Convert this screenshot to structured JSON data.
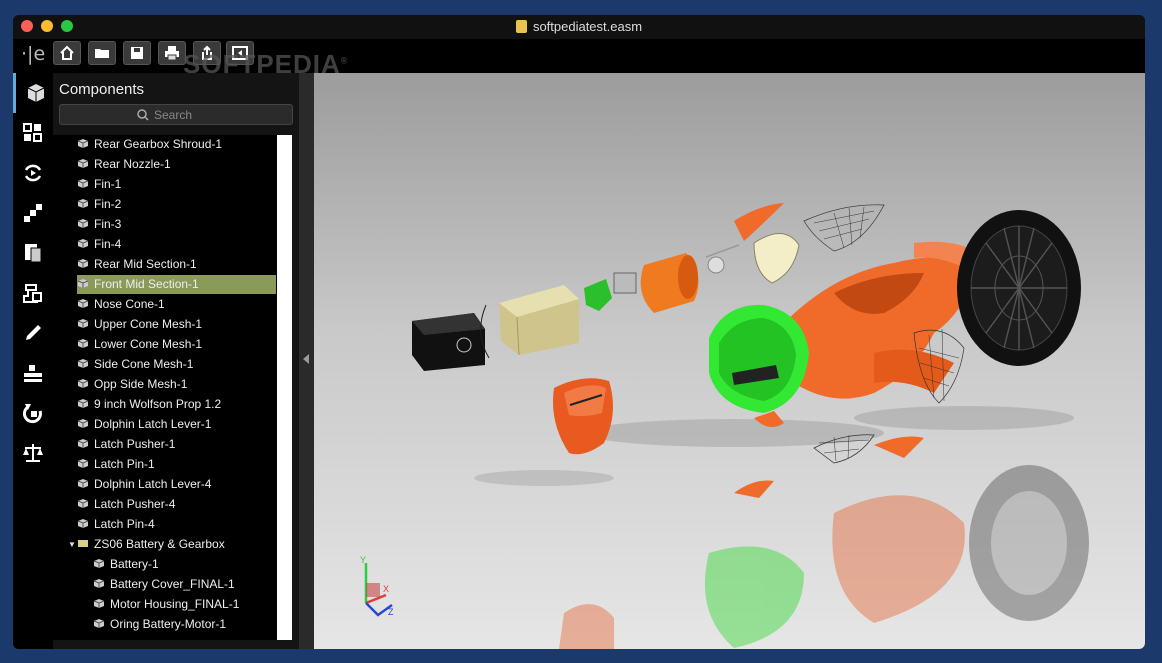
{
  "window": {
    "title": "softpediatest.easm"
  },
  "toolbar": {
    "brand": "·|e",
    "buttons": [
      "home-icon",
      "folder-icon",
      "save-icon",
      "print-icon",
      "share-icon",
      "panel-toggle-icon"
    ]
  },
  "watermark": "SOFTPEDIA",
  "rail": {
    "icons": [
      "components-icon",
      "views-icon",
      "animation-icon",
      "steps-icon",
      "markup-icon",
      "stamp-icon",
      "pen-icon",
      "measure-icon",
      "rotate-icon",
      "scale-icon"
    ]
  },
  "panel": {
    "title": "Components",
    "search_placeholder": "Search",
    "items": [
      "Rear Gearbox Shroud-1",
      "Rear Nozzle-1",
      "Fin-1",
      "Fin-2",
      "Fin-3",
      "Fin-4",
      "Rear Mid Section-1",
      "Front Mid Section-1",
      "Nose Cone-1",
      "Upper Cone Mesh-1",
      "Lower Cone Mesh-1",
      "Side Cone Mesh-1",
      "Opp Side Mesh-1",
      "9 inch Wolfson Prop 1.2",
      "Dolphin Latch Lever-1",
      "Latch Pusher-1",
      "Latch Pin-1",
      "Dolphin Latch Lever-4",
      "Latch Pusher-4",
      "Latch Pin-4"
    ],
    "group": "ZS06 Battery & Gearbox",
    "children": [
      "Battery-1",
      "Battery Cover_FINAL-1",
      "Motor Housing_FINAL-1",
      "Oring Battery-Motor-1"
    ],
    "selected": "Front Mid Section-1"
  },
  "colors": {
    "accent": "#8a9a58",
    "orange": "#f06a2a",
    "green": "#2ee82e"
  },
  "axes": {
    "x": "X",
    "y": "Y",
    "z": "Z"
  }
}
